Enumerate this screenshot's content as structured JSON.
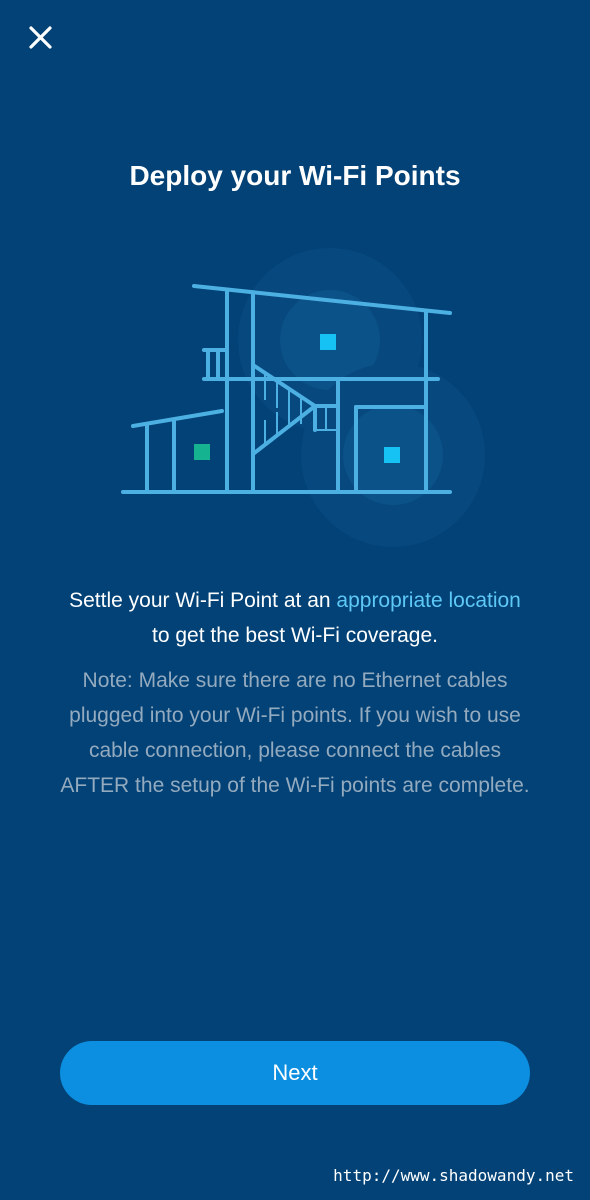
{
  "header": {
    "close_icon": "close-icon"
  },
  "title": "Deploy your Wi-Fi Points",
  "illustration": {
    "icon": "house-wifi-points-illustration",
    "colors": {
      "line": "#4cb0e3",
      "coverage": "#0b5288",
      "point_cyan": "#16c1f3",
      "point_green": "#15b38f"
    }
  },
  "instructions": {
    "line1_prefix": "Settle your Wi-Fi Point at an ",
    "link": "appropriate location",
    "line2": "to get the best Wi-Fi coverage."
  },
  "note": {
    "line1": "Note: Make sure there are no Ethernet cables",
    "line2": "plugged into your Wi-Fi points. If you wish to use",
    "line3": "cable connection, please connect the cables",
    "line4": "AFTER the setup of the Wi-Fi points are complete."
  },
  "footer": {
    "next_label": "Next"
  },
  "watermark": "http://www.shadowandy.net",
  "colors": {
    "background": "#024276",
    "button": "#0c8fe0",
    "link": "#5ec8f7",
    "note_text": "#93aabf"
  }
}
